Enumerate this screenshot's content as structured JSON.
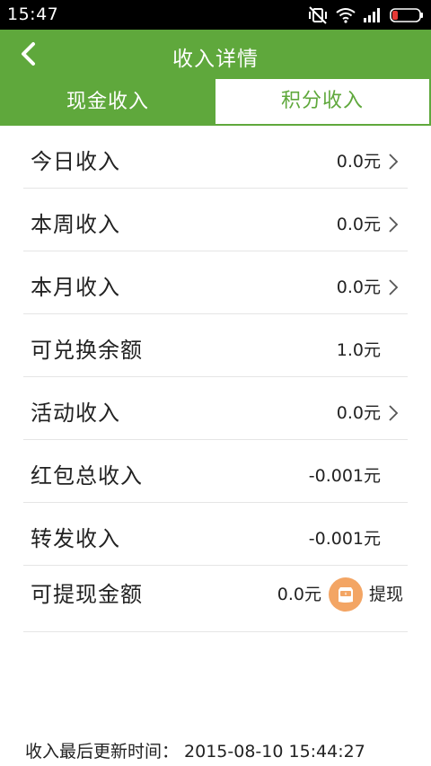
{
  "status_bar": {
    "time": "15:47",
    "icons": [
      "vibrate-off-icon",
      "wifi-icon",
      "signal-icon",
      "battery-icon"
    ]
  },
  "app_bar": {
    "title": "收入详情",
    "back_icon": "back-arrow-icon"
  },
  "tabs": [
    {
      "label": "现金收入",
      "selected": false
    },
    {
      "label": "积分收入",
      "selected": true
    }
  ],
  "rows": [
    {
      "label": "今日收入",
      "value": "0.0元",
      "has_chevron": true
    },
    {
      "label": "本周收入",
      "value": "0.0元",
      "has_chevron": true
    },
    {
      "label": "本月收入",
      "value": "0.0元",
      "has_chevron": true
    },
    {
      "label": "可兑换余额",
      "value": "1.0元",
      "has_chevron": false
    },
    {
      "label": "活动收入",
      "value": "0.0元",
      "has_chevron": true
    },
    {
      "label": "红包总收入",
      "value": "-0.001元",
      "has_chevron": false
    },
    {
      "label": "转发收入",
      "value": "-0.001元",
      "has_chevron": false
    },
    {
      "label": "可提现金额",
      "value": "0.0元",
      "has_chevron": false
    }
  ],
  "withdraw": {
    "label": "提现",
    "icon": "piggy-bank-icon"
  },
  "footer": {
    "label": "收入最后更新时间：",
    "timestamp": "2015-08-10 15:44:27"
  },
  "colors": {
    "brand_green": "#5fa83c",
    "withdraw_orange": "#f3a564"
  }
}
